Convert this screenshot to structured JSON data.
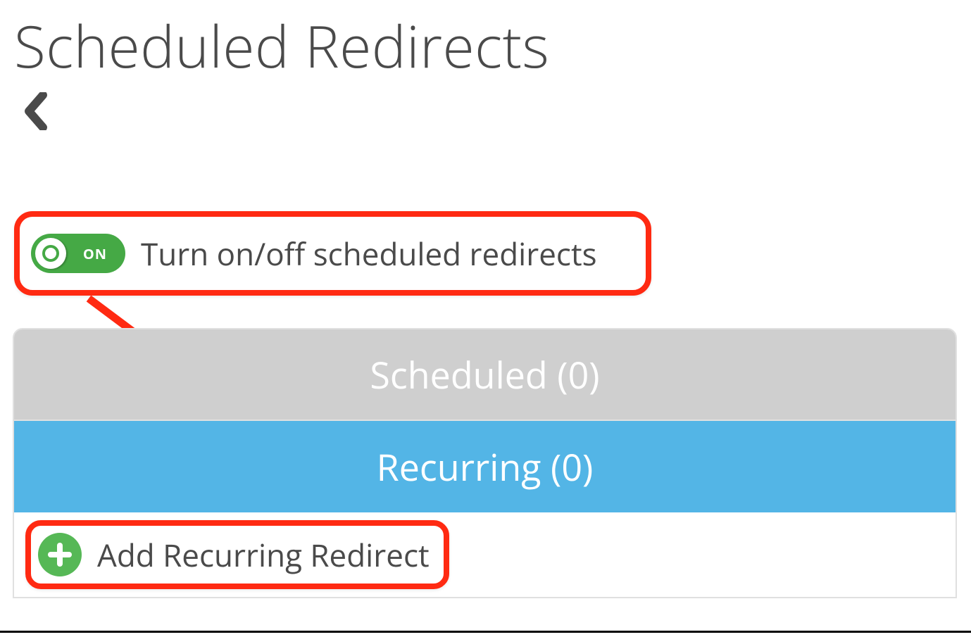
{
  "header": {
    "title": "Scheduled Redirects"
  },
  "toggle": {
    "state_label": "ON",
    "description": "Turn on/off scheduled redirects"
  },
  "tabs": {
    "scheduled": {
      "label": "Scheduled",
      "count": "(0)"
    },
    "recurring": {
      "label": "Recurring",
      "count": "(0)"
    }
  },
  "add_button": {
    "label": "Add Recurring Redirect"
  },
  "colors": {
    "accent_red": "#ff2a12",
    "toggle_green": "#45a945",
    "tab_active_blue": "#53b5e6",
    "tab_inactive_gray": "#cfcfcf",
    "plus_green": "#56b856"
  }
}
